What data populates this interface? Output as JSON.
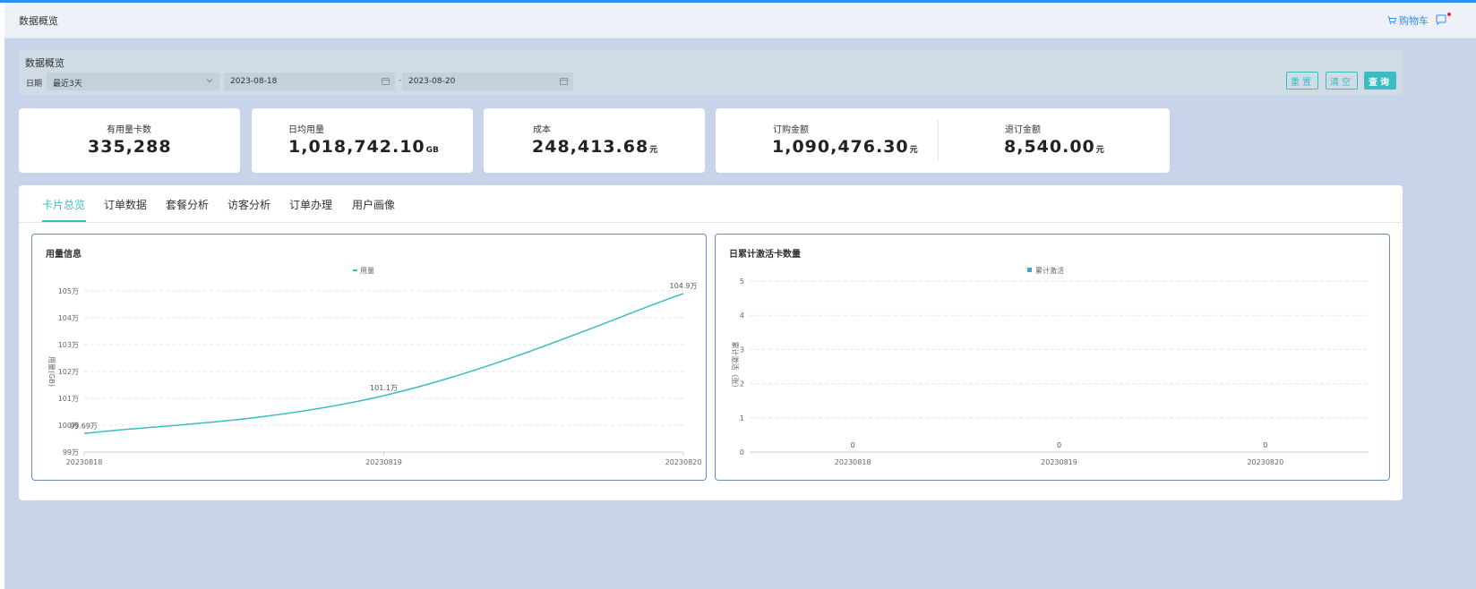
{
  "header": {
    "breadcrumb": "数据概览",
    "cart_label": "购物车",
    "cart_icon": "cart-icon",
    "message_icon": "message-icon"
  },
  "filter": {
    "title": "数据概览",
    "date_label": "日期",
    "range_value": "最近3天",
    "start_date": "2023-08-18",
    "separator": "-",
    "end_date": "2023-08-20",
    "reset_label": "重置",
    "clear_label": "清空",
    "query_label": "查询"
  },
  "stats": {
    "cards_label": "有用量卡数",
    "cards_value": "335,288",
    "daily_label": "日均用量",
    "daily_value": "1,018,742.10",
    "daily_unit": "GB",
    "cost_label": "成本",
    "cost_value": "248,413.68",
    "cost_unit": "元",
    "order_label": "订购金额",
    "order_value": "1,090,476.30",
    "order_unit": "元",
    "refund_label": "退订金额",
    "refund_value": "8,540.00",
    "refund_unit": "元"
  },
  "tabs": [
    {
      "label": "卡片总览",
      "active": true
    },
    {
      "label": "订单数据",
      "active": false
    },
    {
      "label": "套餐分析",
      "active": false
    },
    {
      "label": "访客分析",
      "active": false
    },
    {
      "label": "订单办理",
      "active": false
    },
    {
      "label": "用户画像",
      "active": false
    }
  ],
  "colors": {
    "accent": "#3bbcc2",
    "link": "#2f8cf0",
    "line_series": "#3bbcc2",
    "bar_series": "#3aa7d6"
  },
  "chart_data": [
    {
      "type": "line",
      "title": "用量信息",
      "legend": "用量",
      "legend_position": "top-center",
      "ylabel": "用量(GB)",
      "x": [
        "20230818",
        "20230819",
        "20230820"
      ],
      "series": [
        {
          "name": "用量",
          "values": [
            99.69,
            101.1,
            104.9
          ],
          "labels": [
            "99.69万",
            "101.1万",
            "104.9万"
          ]
        }
      ],
      "yticks": [
        "99万",
        "100万",
        "101万",
        "102万",
        "103万",
        "104万",
        "105万"
      ],
      "ylim": [
        99,
        105
      ],
      "y_unit": "万",
      "smooth": true,
      "grid": "dashed horizontal"
    },
    {
      "type": "bar",
      "title": "日累计激活卡数量",
      "legend": "累计激活",
      "legend_position": "top-center",
      "ylabel": "累计激活（张）",
      "categories": [
        "20230818",
        "20230819",
        "20230820"
      ],
      "series": [
        {
          "name": "累计激活",
          "values": [
            0,
            0,
            0
          ]
        }
      ],
      "yticks": [
        "0",
        "1",
        "2",
        "3",
        "4",
        "5"
      ],
      "ylim": [
        0,
        5
      ],
      "grid": "dashed horizontal"
    }
  ]
}
